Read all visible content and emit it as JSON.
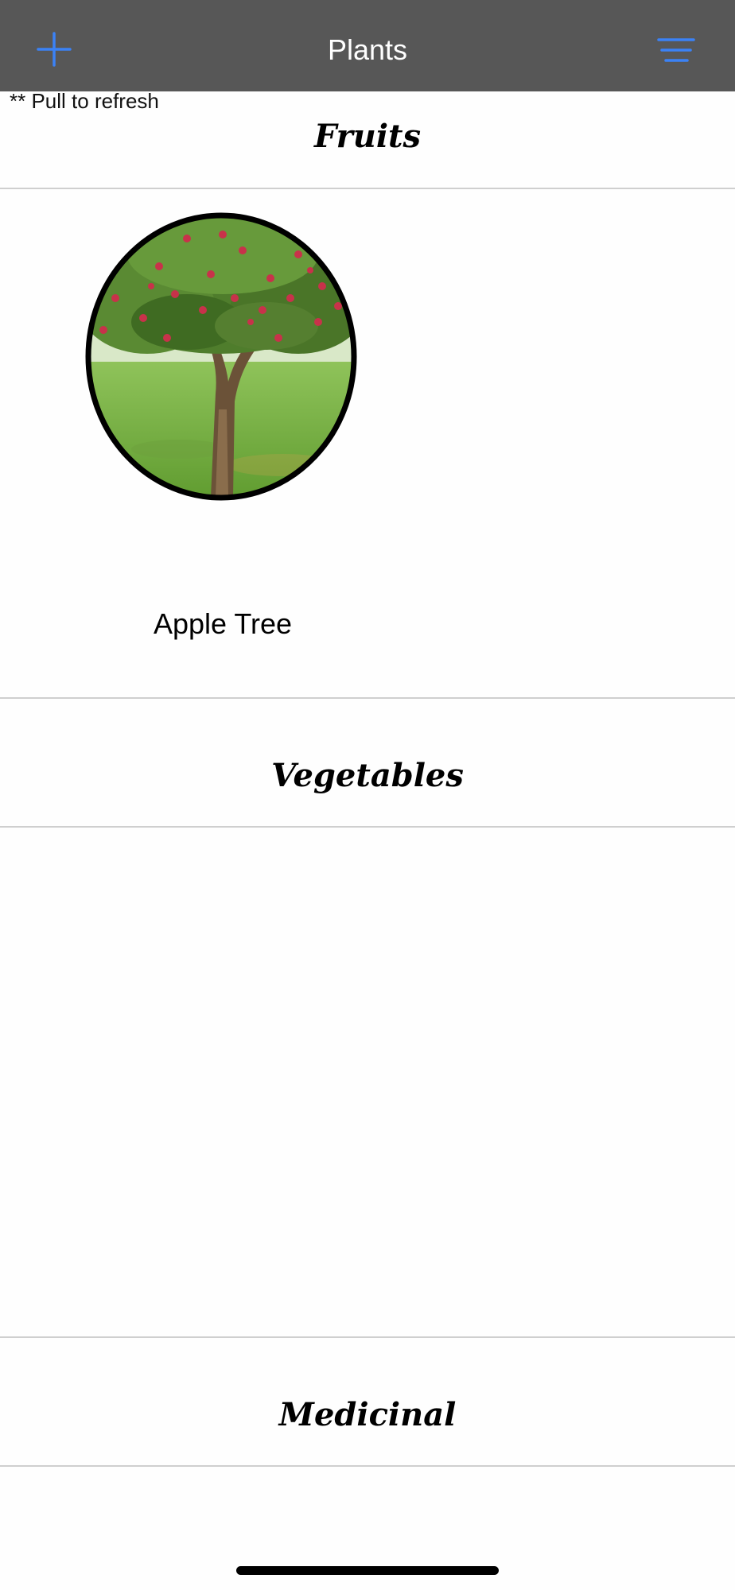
{
  "navbar": {
    "title": "Plants",
    "add_icon": "plus-icon",
    "menu_icon": "hamburger-menu-icon",
    "icon_color": "#3b82f6",
    "background": "#575757"
  },
  "hint": "** Pull to refresh",
  "sections": [
    {
      "title": "Fruits",
      "plants": [
        {
          "name": "Apple Tree",
          "image": "apple-tree-photo"
        }
      ]
    },
    {
      "title": "Vegetables",
      "plants": []
    },
    {
      "title": "Medicinal",
      "plants": []
    }
  ]
}
